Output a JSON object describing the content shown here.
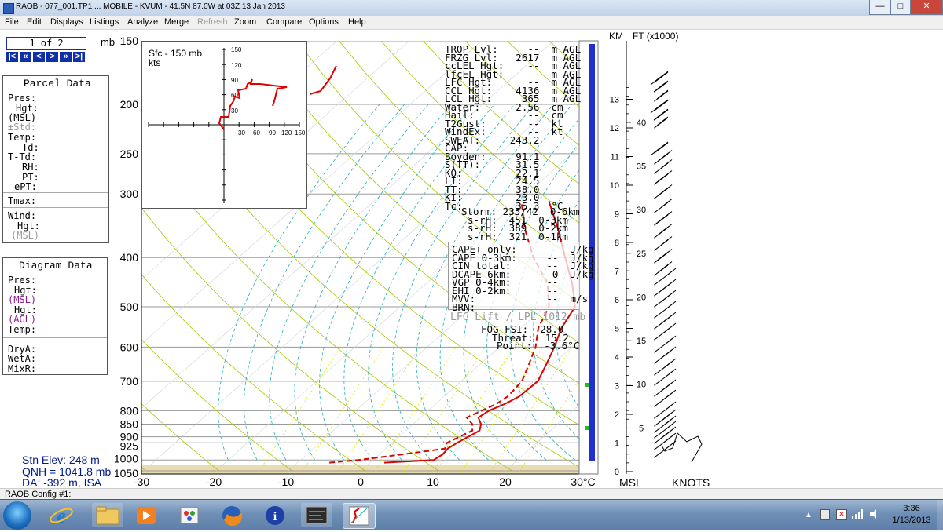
{
  "window": {
    "title": "RAOB - 077_001.TP1 ... MOBILE - KVUM - 41.5N 87.0W at 03Z 13 Jan 2013",
    "minimize": "—",
    "maximize": "□",
    "close": "✕"
  },
  "menu": [
    "File",
    "Edit",
    "Displays",
    "Listings",
    "Analyze",
    "Merge",
    "Refresh",
    "Zoom",
    "Compare",
    "Options",
    "Help"
  ],
  "menu_disabled": "Refresh",
  "page_nav": {
    "label": "1 of 2",
    "mb": "mb",
    "buttons": [
      "|<",
      "«",
      "<",
      ">",
      "»",
      ">|"
    ]
  },
  "parcel": {
    "title": "Parcel Data",
    "rows": [
      "Pres:",
      "Hgt:",
      "(MSL)",
      "±Std:",
      "Temp:",
      "Td:",
      "T-Td:",
      "RH:",
      "PT:",
      "ePT:",
      "Tmax:",
      "Wind:",
      "Hgt:",
      "(MSL)"
    ]
  },
  "diagram": {
    "title": "Diagram Data",
    "rows": [
      "Pres:",
      "Hgt:",
      "(MSL)",
      "Hgt:",
      "(AGL)",
      "Temp:",
      "DryA:",
      "WetA:",
      "MixR:"
    ]
  },
  "station": {
    "elev": "Stn Elev: 248 m",
    "qnh": "QNH = 1041.8 mb",
    "da": "DA: -392 m, ISA"
  },
  "status_bar": "RAOB Config #1:",
  "hodograph": {
    "title": "Sfc - 150 mb",
    "units": "kts",
    "ticks": [
      "30",
      "60",
      "90",
      "120",
      "150"
    ]
  },
  "skewt": {
    "pressure_labels": [
      "150",
      "200",
      "250",
      "300",
      "400",
      "500",
      "600",
      "700",
      "800",
      "850",
      "900",
      "925",
      "1000",
      "1050"
    ],
    "temp_labels": [
      "-30",
      "-20",
      "-10",
      "0",
      "10",
      "20",
      "30°C"
    ],
    "profile_temperature": [
      [
        1012,
        2.0
      ],
      [
        1000,
        8.4
      ],
      [
        975,
        8.8
      ],
      [
        950,
        8.6
      ],
      [
        925,
        9.0
      ],
      [
        900,
        9.6
      ],
      [
        875,
        10.2
      ],
      [
        850,
        9.4
      ],
      [
        825,
        8.0
      ],
      [
        800,
        8.4
      ],
      [
        775,
        9.6
      ],
      [
        750,
        10.4
      ],
      [
        700,
        10.6
      ],
      [
        650,
        9.2
      ],
      [
        600,
        7.6
      ],
      [
        550,
        5.6
      ],
      [
        500,
        4.2
      ],
      [
        450,
        0.2
      ],
      [
        400,
        -4.8
      ],
      [
        350,
        -10.4
      ],
      [
        310,
        -15.8
      ]
    ],
    "profile_dewpoint": [
      [
        1012,
        -5.6
      ],
      [
        1000,
        -2.0
      ],
      [
        975,
        3.2
      ],
      [
        950,
        8.2
      ],
      [
        925,
        7.6
      ],
      [
        900,
        8.4
      ],
      [
        875,
        9.2
      ],
      [
        850,
        8.2
      ],
      [
        825,
        6.4
      ],
      [
        800,
        7.4
      ],
      [
        775,
        8.4
      ],
      [
        750,
        8.8
      ],
      [
        700,
        8.4
      ],
      [
        650,
        6.8
      ],
      [
        600,
        5.0
      ],
      [
        550,
        2.4
      ],
      [
        500,
        0.6
      ],
      [
        450,
        -3.2
      ],
      [
        400,
        -9.2
      ],
      [
        350,
        -15.0
      ],
      [
        310,
        -19.6
      ]
    ],
    "upper_segment": [
      [
        150,
        -4
      ],
      [
        175,
        -6
      ],
      [
        185,
        -10
      ]
    ]
  },
  "stats_top": [
    "TROP Lvl:     --  m AGL",
    "FRZG Lvl:   2617  m AGL",
    "ccLEL Hgt:    --  m AGL",
    "lfcEL Hgt:    --  m AGL",
    "LFC Hgt:      --  m AGL",
    "CCL Hgt:    4136  m AGL",
    "LCL Hgt:     365  m AGL",
    "Water:      2.56  cm",
    "Hail:         --  cm",
    "T2Gust:       --  kt",
    "WindEx:       --  kt",
    "SWEAT:     243.2",
    "CAP:",
    "Boyden:     91.1",
    "S(TT):      31.5",
    "KO:         22.1",
    "LI:         24.5",
    "TT:         38.0",
    "KI:         23.0",
    "Tc:         35.3  °C"
  ],
  "stats_storm": [
    "Storm: 235/42  0-6km",
    "s-rH:  451  0-3km",
    "s-rH:  389  0-2km",
    "s-rH:  321  0-1km"
  ],
  "stats_cape": [
    "CAPE+ only:     --  J/kg",
    "CAPE 0-3km:     --  J/kg",
    "CIN total:      --  J/kg",
    "DCAPE 6km:       0  J/kg",
    "VGP 0-4km:      --",
    "EHI 0-2km:      --",
    "MVV:            --  m/s",
    "BRN:            --"
  ],
  "lfc_lift": "LFC Lift / LPL 1012 mb",
  "fog": [
    "FOG FSI:  28.0",
    "Threat:  15.2",
    "Point:  -3.6°C"
  ],
  "height_axis": {
    "km_label": "KM",
    "ft_label": "FT (x1000)",
    "km_ticks": [
      "0",
      "1",
      "2",
      "3",
      "4",
      "5",
      "6",
      "7",
      "8",
      "9",
      "10",
      "11",
      "12",
      "13"
    ],
    "ft_ticks": [
      "5",
      "10",
      "15",
      "20",
      "25",
      "30",
      "35",
      "40"
    ],
    "msl": "MSL",
    "knots": "KNOTS"
  },
  "clock": {
    "time": "3:36",
    "date": "1/13/2013"
  },
  "taskbar_apps": [
    "start-orb",
    "internet-explorer",
    "file-explorer",
    "media-player",
    "paint",
    "firefox",
    "info-app",
    "raob-terminal",
    "raob-skewt"
  ],
  "colors": {
    "profile": "#e00000",
    "isobar": "#9a9a9a",
    "dry_adiabat": "#a8c800",
    "moist_adiabat": "#22b0b8",
    "mixing_ratio": "#d8e400",
    "height_bar": "#1f2fd0",
    "surface_band": "#e8dcb0",
    "nav_button": "#1030a8"
  }
}
